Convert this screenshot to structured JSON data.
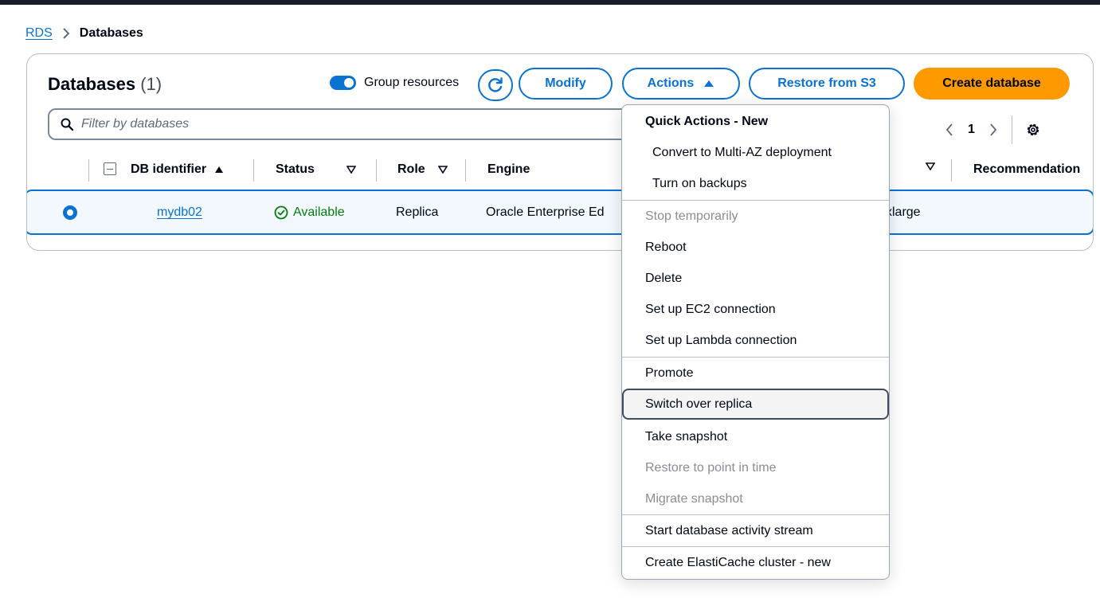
{
  "breadcrumb": {
    "parent": "RDS",
    "current": "Databases"
  },
  "header": {
    "title": "Databases",
    "count": "(1)",
    "group_resources_label": "Group resources",
    "modify_label": "Modify",
    "actions_label": "Actions",
    "restore_label": "Restore from S3",
    "create_label": "Create database"
  },
  "filter": {
    "placeholder": "Filter by databases"
  },
  "pagination": {
    "page": "1"
  },
  "table": {
    "columns": [
      "DB identifier",
      "Status",
      "Role",
      "Engine",
      "Recommendation"
    ],
    "rows": [
      {
        "id": "mydb02",
        "status": "Available",
        "role": "Replica",
        "engine": "Oracle Enterprise Ed",
        "size": "xlarge"
      }
    ]
  },
  "actions_menu": {
    "group_title": "Quick Actions - New",
    "items": [
      "Convert to Multi-AZ deployment",
      "Turn on backups",
      "Stop temporarily",
      "Reboot",
      "Delete",
      "Set up EC2 connection",
      "Set up Lambda connection",
      "Promote",
      "Switch over replica",
      "Take snapshot",
      "Restore to point in time",
      "Migrate snapshot",
      "Start database activity stream",
      "Create ElastiCache cluster - new"
    ]
  },
  "colors": {
    "primary": "#0972d3",
    "create_button": "#ff9900",
    "status_available": "#037f0c",
    "disabled_text": "#8c8c94",
    "top_bar": "#161d26"
  }
}
